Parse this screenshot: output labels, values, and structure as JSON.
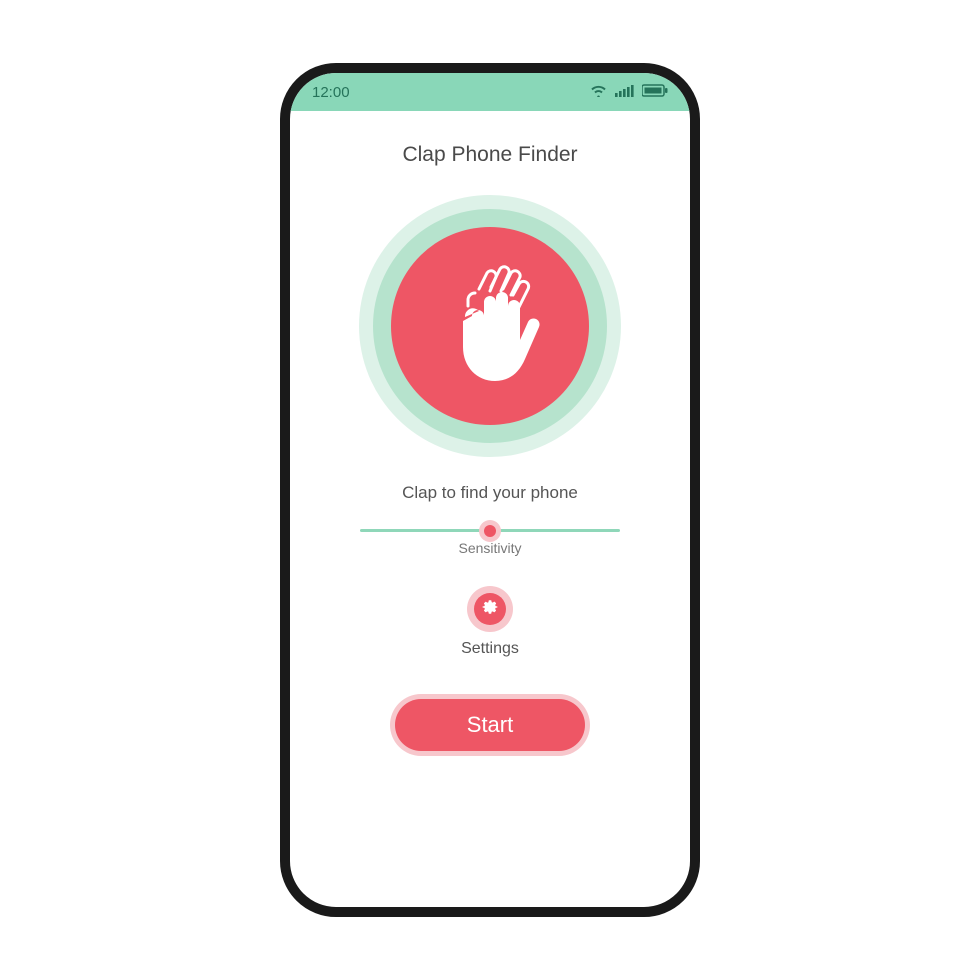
{
  "status": {
    "time": "12:00"
  },
  "title": "Clap Phone Finder",
  "subtitle": "Clap to find your phone",
  "slider": {
    "label": "Sensitivity",
    "value_percent": 50
  },
  "settings": {
    "label": "Settings"
  },
  "start": {
    "label": "Start"
  },
  "colors": {
    "accent": "#ee5665",
    "mint": "#89d7b8"
  }
}
